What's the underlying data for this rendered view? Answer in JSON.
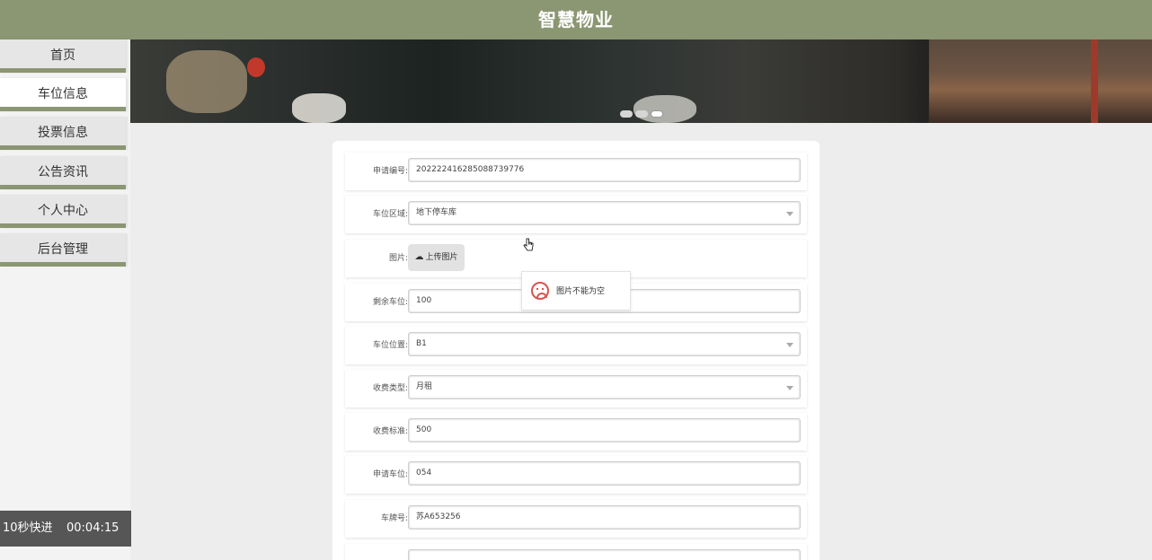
{
  "header": {
    "title": "智慧物业"
  },
  "sidebar": {
    "items": [
      {
        "label": "首页"
      },
      {
        "label": "车位信息"
      },
      {
        "label": "投票信息"
      },
      {
        "label": "公告资讯"
      },
      {
        "label": "个人中心"
      },
      {
        "label": "后台管理"
      }
    ],
    "active_index": 1
  },
  "form": {
    "apply_no": {
      "label": "申请编号:",
      "value": "202222416285088739776"
    },
    "area": {
      "label": "车位区域:",
      "value": "地下停车库"
    },
    "image": {
      "label": "图片:",
      "upload_label": "上传图片"
    },
    "remaining": {
      "label": "剩余车位:",
      "value": "100"
    },
    "position": {
      "label": "车位位置:",
      "value": "B1"
    },
    "fee_type": {
      "label": "收费类型:",
      "value": "月租"
    },
    "fee_std": {
      "label": "收费标准:",
      "value": "500"
    },
    "spot": {
      "label": "申请车位:",
      "value": "054"
    },
    "plate": {
      "label": "车牌号:",
      "value": "苏A653256"
    }
  },
  "toast": {
    "message": "图片不能为空"
  },
  "fast_forward": {
    "label": "10秒快进",
    "time": "00:04:15"
  },
  "colors": {
    "accent": "#8b9672",
    "error": "#d9534f"
  }
}
